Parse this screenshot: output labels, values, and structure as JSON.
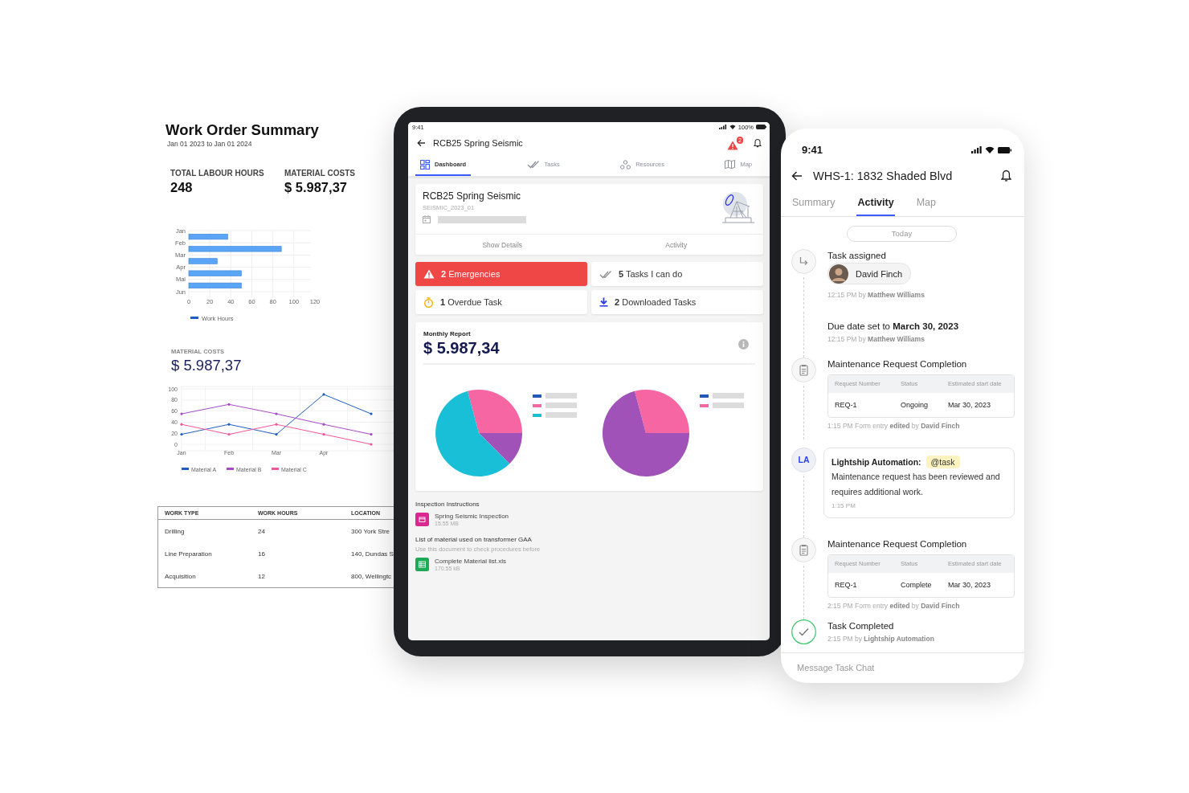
{
  "report": {
    "title": "Work Order Summary",
    "date_range": "Jan 01 2023 to Jan 01 2024",
    "stats": [
      {
        "label": "TOTAL LABOUR HOURS",
        "value": "248"
      },
      {
        "label": "MATERIAL COSTS",
        "value": "$ 5.987,37"
      }
    ],
    "hours_chart": {
      "chart_data": {
        "type": "bar",
        "orientation": "horizontal",
        "grid": true,
        "legend": "bottom",
        "categories": [
          "Jan",
          "Feb",
          "Mar",
          "Apr",
          "Mai",
          "Jun"
        ],
        "xlim": [
          0,
          120
        ],
        "xticks": [
          0,
          20,
          40,
          60,
          80,
          100,
          120
        ],
        "series": [
          {
            "name": "Work Hours",
            "color": "#5aa5f5",
            "values": [
              37,
              88,
              27,
              50,
              50,
              null
            ]
          }
        ]
      }
    },
    "material": {
      "label": "MATERIAL COSTS",
      "value": "$ 5.987,37",
      "chart_data": {
        "type": "line",
        "grid": true,
        "legend": "bottom",
        "categories": [
          "Jan",
          "Feb",
          "Mar",
          "Apr",
          null
        ],
        "ylim": [
          0,
          100
        ],
        "yticks": [
          0,
          20,
          40,
          60,
          80,
          100
        ],
        "series": [
          {
            "name": "Material A",
            "color": "#1f5fbf",
            "values": [
              18,
              36,
              18,
              90,
              55
            ]
          },
          {
            "name": "Material B",
            "color": "#a64ac9",
            "values": [
              55,
              72,
              55,
              36,
              18
            ]
          },
          {
            "name": "Material C",
            "color": "#f0569a",
            "values": [
              36,
              18,
              36,
              18,
              0
            ]
          }
        ]
      }
    },
    "table": {
      "columns": [
        "WORK TYPE",
        "WORK HOURS",
        "LOCATION"
      ],
      "rows": [
        [
          "Drilling",
          "24",
          "300 York Stre"
        ],
        [
          "Line Preparation",
          "16",
          "140, Dundas S"
        ],
        [
          "Acquisition",
          "12",
          "800, Wellingtc"
        ]
      ]
    }
  },
  "tablet": {
    "status_bar": {
      "time": "9:41",
      "battery": "100%"
    },
    "title": "RCB25 Spring Seismic",
    "alert_count": "2",
    "tabs": [
      {
        "kind": "dashboard",
        "label": "Dashboard",
        "selected": true
      },
      {
        "kind": "tasks",
        "label": "Tasks",
        "selected": false
      },
      {
        "kind": "resources",
        "label": "Resources",
        "selected": false
      },
      {
        "kind": "map",
        "label": "Map",
        "selected": false
      }
    ],
    "project": {
      "title": "RCB25 Spring Seismic",
      "code": "SEISMIC_2023_01",
      "actions": [
        "Show Details",
        "Activity"
      ]
    },
    "tiles": [
      {
        "kind": "emergency",
        "count": "2",
        "label": "Emergencies"
      },
      {
        "kind": "tasks",
        "count": "5",
        "label": "Tasks I can do"
      },
      {
        "kind": "overdue",
        "count": "1",
        "label": "Overdue Task"
      },
      {
        "kind": "downloaded",
        "count": "2",
        "label": "Downloaded Tasks"
      }
    ],
    "monthly": {
      "title": "Monthly Report",
      "amount": "$ 5.987,34",
      "legends": [
        [
          {
            "color": "#1e5bb8"
          },
          {
            "color": "#f566a3"
          },
          {
            "color": "#19bfd6"
          }
        ],
        [
          {
            "color": "#1e5bb8"
          },
          {
            "color": "#f566a3"
          }
        ]
      ]
    },
    "sections": [
      {
        "heading": "Inspection Instructions",
        "files": [
          {
            "kind": "calendar",
            "name": "Spring Seismic Inspection",
            "size": "15.55 MB"
          }
        ]
      },
      {
        "heading": "List of material used on transformer GAA",
        "note": "Use this document to check procedures before",
        "files": [
          {
            "kind": "sheet",
            "name": "Complete Material list.xls",
            "size": "170.55 kB"
          }
        ]
      }
    ]
  },
  "phone": {
    "time": "9:41",
    "title": "WHS-1: 1832 Shaded Blvd",
    "tabs": [
      {
        "label": "Summary",
        "selected": false
      },
      {
        "label": "Activity",
        "selected": true
      },
      {
        "label": "Map",
        "selected": false
      }
    ],
    "day": "Today",
    "events": [
      {
        "kind": "assigned",
        "title": "Task assigned",
        "person": "David Finch",
        "meta": "12:15 PM  by **Matthew Williams**"
      },
      {
        "kind": "due",
        "title": "Due date set to **March 30, 2023**",
        "meta": "12:15 PM  by **Matthew Williams**"
      },
      {
        "kind": "form",
        "title": "Maintenance Request Completion",
        "columns": [
          "Request Number",
          "Status",
          "Estimated start date"
        ],
        "row": [
          "REQ-1",
          "Ongoing",
          "Mar 30, 2023"
        ],
        "meta": "1:15 PM Form entry **edited** by **David Finch**"
      },
      {
        "kind": "comment",
        "initials": "LA",
        "author": "Lightship Automation:",
        "tag": "@task",
        "text": "Maintenance request has been reviewed and requires additional work.",
        "time": "1:15 PM"
      },
      {
        "kind": "form",
        "title": "Maintenance Request Completion",
        "columns": [
          "Request Number",
          "Status",
          "Estimated start date"
        ],
        "row": [
          "REQ-1",
          "Complete",
          "Mar 30, 2023"
        ],
        "meta": "2:15 PM Form entry **edited** by **David Finch**"
      },
      {
        "kind": "completed",
        "title": "Task Completed",
        "meta": "2:15 PM  by **Lightship Automation**"
      }
    ],
    "message": {
      "placeholder": "Message Task Chat"
    }
  }
}
